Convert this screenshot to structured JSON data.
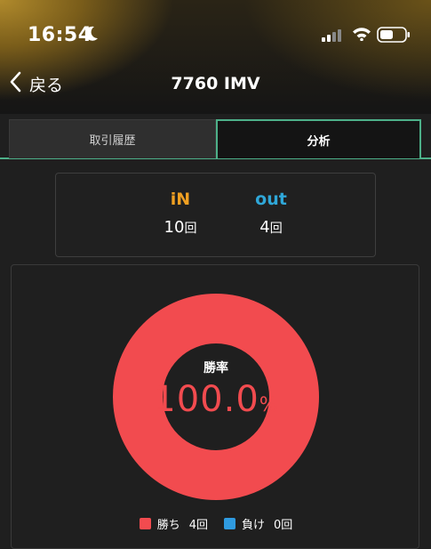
{
  "status_bar": {
    "time": "16:54"
  },
  "nav": {
    "back_label": "戻る",
    "title": "7760 IMV"
  },
  "tabs": [
    {
      "label": "取引履歴",
      "active": false
    },
    {
      "label": "分析",
      "active": true
    }
  ],
  "summary": {
    "in": {
      "logo": "iN",
      "count": "10",
      "unit": "回"
    },
    "out": {
      "logo": "out",
      "count": "4",
      "unit": "回"
    }
  },
  "win_rate": {
    "label": "勝率",
    "value": "100.0",
    "unit": "%"
  },
  "legend": [
    {
      "label": "勝ち",
      "value": "4回",
      "color": "#f24b4f"
    },
    {
      "label": "負け",
      "value": "0回",
      "color": "#2f9be0"
    }
  ],
  "chart_data": {
    "type": "pie",
    "categories": [
      "勝ち",
      "負け"
    ],
    "values": [
      4,
      0
    ],
    "colors": [
      "#f24b4f",
      "#2f9be0"
    ],
    "title": "勝率",
    "center_text": "100.0%"
  }
}
